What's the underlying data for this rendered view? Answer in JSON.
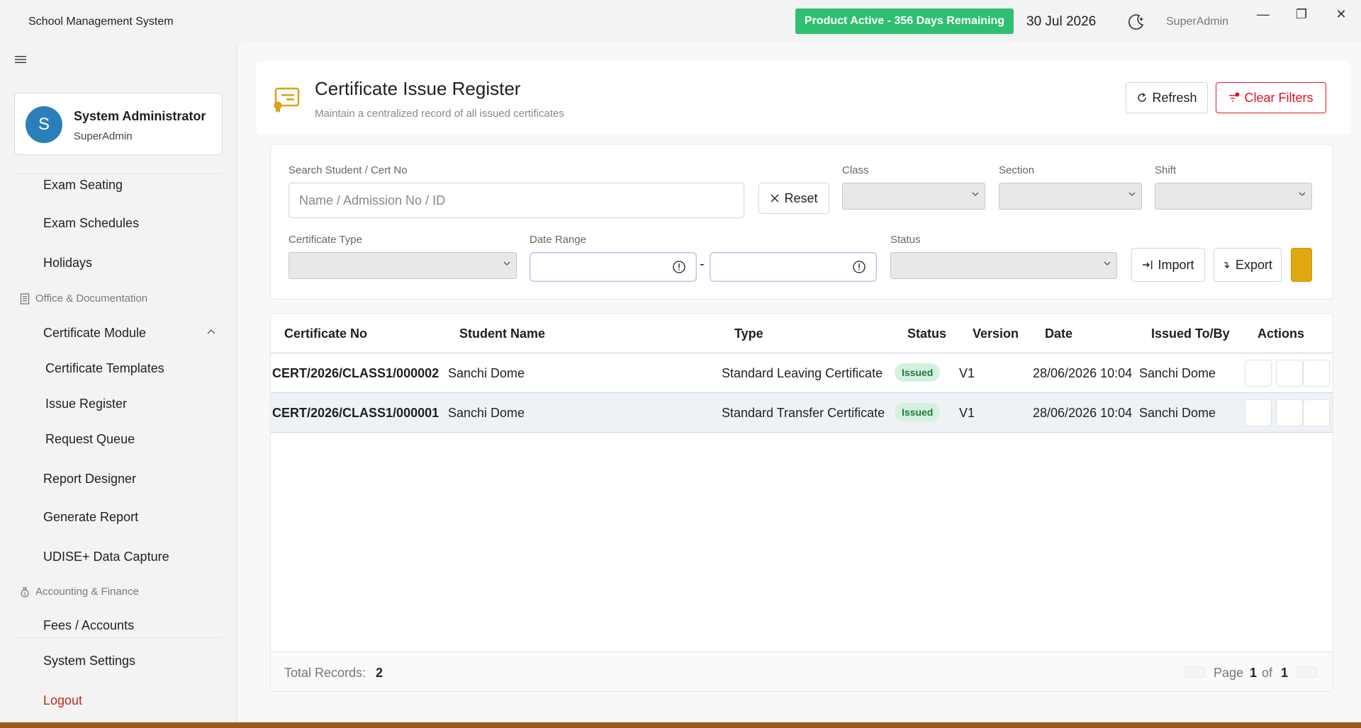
{
  "titlebar": {
    "app_title": "School Management System",
    "product_badge": "Product Active - 356 Days Remaining",
    "date": "30 Jul 2026",
    "user": "SuperAdmin",
    "minimize": "—",
    "restore": "❐",
    "close": "✕"
  },
  "sidebar": {
    "profile": {
      "initial": "S",
      "name": "System Administrator",
      "role": "SuperAdmin"
    },
    "items": {
      "exam_seating": "Exam Seating",
      "exam_schedules": "Exam Schedules",
      "holidays": "Holidays",
      "office_section": "Office & Documentation",
      "certificate_module": "Certificate Module",
      "certificate_templates": "Certificate Templates",
      "issue_register": "Issue Register",
      "request_queue": "Request Queue",
      "report_designer": "Report Designer",
      "generate_report": "Generate Report",
      "udise": "UDISE+ Data Capture",
      "accounting_section": "Accounting & Finance",
      "fees": "Fees / Accounts",
      "system_settings": "System Settings",
      "logout": "Logout"
    }
  },
  "header": {
    "title": "Certificate Issue Register",
    "subtitle": "Maintain a centralized record of all issued certificates",
    "refresh_label": "Refresh",
    "clear_filters_label": "Clear Filters"
  },
  "filters": {
    "search_label": "Search Student / Cert No",
    "search_placeholder": "Name / Admission No / ID",
    "reset_label": "Reset",
    "class_label": "Class",
    "section_label": "Section",
    "shift_label": "Shift",
    "cert_type_label": "Certificate Type",
    "date_range_label": "Date Range",
    "date_separator": "-",
    "status_label": "Status",
    "import_label": "Import",
    "export_label": "Export"
  },
  "table": {
    "headers": {
      "cert_no": "Certificate No",
      "student": "Student Name",
      "type": "Type",
      "status": "Status",
      "version": "Version",
      "date": "Date",
      "issued_to": "Issued To/By",
      "actions": "Actions"
    },
    "rows": [
      {
        "cert_no": "CERT/2026/CLASS1/000002",
        "student": "Sanchi Dome",
        "type": "Standard Leaving Certificate",
        "status": "Issued",
        "version": "V1",
        "date": "28/06/2026 10:04",
        "issued_to": "Sanchi Dome"
      },
      {
        "cert_no": "CERT/2026/CLASS1/000001",
        "student": "Sanchi Dome",
        "type": "Standard Transfer Certificate",
        "status": "Issued",
        "version": "V1",
        "date": "28/06/2026 10:04",
        "issued_to": "Sanchi Dome"
      }
    ],
    "footer": {
      "total_label": "Total Records:",
      "total_value": "2",
      "page_label": "Page",
      "page_current": "1",
      "page_of": "of",
      "page_total": "1"
    }
  },
  "colors": {
    "accent": "#2fbf71",
    "brand_gold": "#d9a21a",
    "danger": "#e81123",
    "avatar": "#2a7fba"
  }
}
